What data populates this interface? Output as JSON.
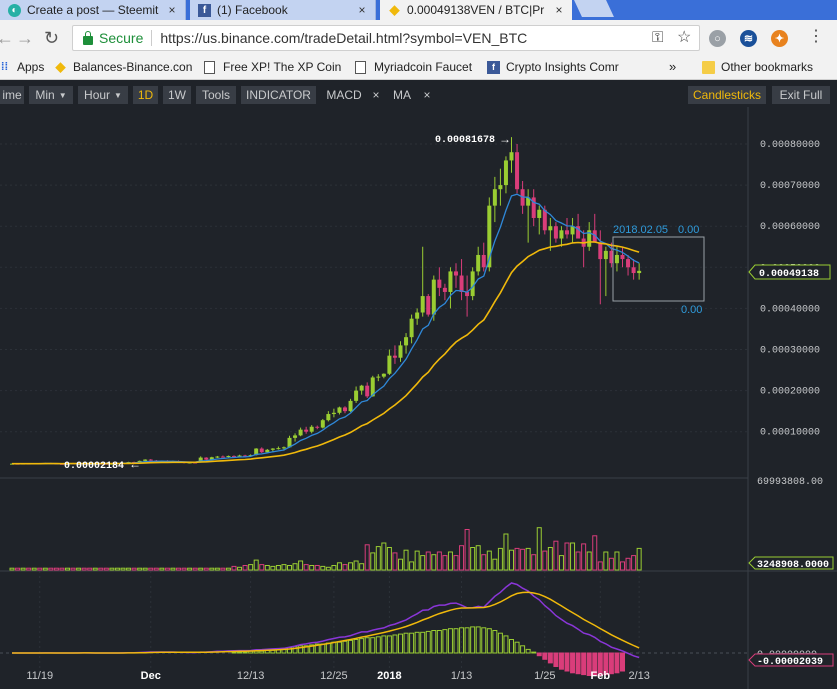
{
  "browser": {
    "tabs": [
      {
        "title": "Create a post — Steemit",
        "icon": "steemit-icon",
        "active": false
      },
      {
        "title": "(1) Facebook",
        "icon": "facebook-icon",
        "active": false
      },
      {
        "title": "0.00049138VEN / BTC|Pr",
        "icon": "binance-icon",
        "active": true
      }
    ],
    "secure_label": "Secure",
    "url": "https://us.binance.com/tradeDetail.html?symbol=VEN_BTC",
    "bookmarks": [
      {
        "label": "Apps",
        "icon": "apps-grid-icon"
      },
      {
        "label": "Balances-Binance.con",
        "icon": "binance-icon"
      },
      {
        "label": "Free XP! The XP Coin",
        "icon": "page-icon"
      },
      {
        "label": "Myriadcoin Faucet",
        "icon": "page-icon"
      },
      {
        "label": "Crypto Insights Comr",
        "icon": "facebook-icon"
      }
    ],
    "more_bookmarks": "»",
    "other_bookmarks": "Other bookmarks"
  },
  "toolbar": {
    "time_label": "ime",
    "min_label": "Min",
    "hour_label": "Hour",
    "d1_label": "1D",
    "w1_label": "1W",
    "tools_label": "Tools",
    "indicator_label": "INDICATOR",
    "macd_label": "MACD",
    "ma_label": "MA",
    "close_glyph": "×",
    "candlesticks_label": "Candlesticks",
    "exit_label": "Exit Full"
  },
  "colors": {
    "up": "#9acd32",
    "down": "#d93d7a",
    "ma_fast": "#2f88d8",
    "ma_slow": "#f0b90b",
    "macd_line": "#8a36d8",
    "accent": "#f0b90b"
  },
  "chart_data": {
    "type": "candlestick",
    "pair": "VEN / BTC",
    "interval": "1D",
    "y_ticks": [
      "0.00080000",
      "0.00070000",
      "0.00060000",
      "0.00050000",
      "0.00040000",
      "0.00030000",
      "0.00020000",
      "0.00010000"
    ],
    "y_range": [
      0.0,
      0.00081678
    ],
    "x_ticks": [
      "11/19",
      "Dec",
      "12/13",
      "12/25",
      "2018",
      "1/13",
      "1/25",
      "Feb",
      "2/13"
    ],
    "annotations": {
      "high_label": "0.00081678",
      "low_label": "0.00002184",
      "current_price": "0.00049138",
      "range_date": "2018.02.05",
      "range_top_value": "0.00",
      "range_bottom_value": "0.00"
    },
    "volume": {
      "max_label": "69993808.00",
      "current_label": "3248908.0000"
    },
    "macd": {
      "zero_label": "0.00000000",
      "current_label": "-0.00002039"
    },
    "candles": [
      [
        2.15e-05,
        2.28e-05,
        2.08e-05,
        2.22e-05
      ],
      [
        2.22e-05,
        2.35e-05,
        2.12e-05,
        2.18e-05
      ],
      [
        2.18e-05,
        2.3e-05,
        2.1e-05,
        2.25e-05
      ],
      [
        2.25e-05,
        2.36e-05,
        2.15e-05,
        2.19e-05
      ],
      [
        2.19e-05,
        2.38e-05,
        2.14e-05,
        2.32e-05
      ],
      [
        2.32e-05,
        2.4e-05,
        2.16e-05,
        2.2e-05
      ],
      [
        2.2e-05,
        2.41e-05,
        2.14e-05,
        2.36e-05
      ],
      [
        2.36e-05,
        2.44e-05,
        2.22e-05,
        2.26e-05
      ],
      [
        2.26e-05,
        2.36e-05,
        2.11e-05,
        2.18e-05
      ],
      [
        2.18e-05,
        2.28e-05,
        2.08e-05,
        2.15e-05
      ],
      [
        2.15e-05,
        2.38e-05,
        2.1e-05,
        2.31e-05
      ],
      [
        2.31e-05,
        2.43e-05,
        2.2e-05,
        2.25e-05
      ],
      [
        2.25e-05,
        2.4e-05,
        2.18e-05,
        2.36e-05
      ],
      [
        2.36e-05,
        2.46e-05,
        2.24e-05,
        2.28e-05
      ],
      [
        2.28e-05,
        2.34e-05,
        2.1e-05,
        2.18e-05
      ],
      [
        2.18e-05,
        2.3e-05,
        2.12e-05,
        2.24e-05
      ],
      [
        2.24e-05,
        2.36e-05,
        2.18e-05,
        2.21e-05
      ],
      [
        2.21e-05,
        2.25e-05,
        2.09e-05,
        2.13e-05
      ],
      [
        2.13e-05,
        2.25e-05,
        2.07e-05,
        2.2e-05
      ],
      [
        2.2e-05,
        2.42e-05,
        2.15e-05,
        2.36e-05
      ],
      [
        2.36e-05,
        2.55e-05,
        2.3e-05,
        2.48e-05
      ],
      [
        2.48e-05,
        2.68e-05,
        2.4e-05,
        2.62e-05
      ],
      [
        2.62e-05,
        2.72e-05,
        2.4e-05,
        2.48e-05
      ],
      [
        2.48e-05,
        2.98e-05,
        2.46e-05,
        2.9e-05
      ],
      [
        2.9e-05,
        3.3e-05,
        2.8e-05,
        3.22e-05
      ],
      [
        3.22e-05,
        3.35e-05,
        2.9e-05,
        3e-05
      ],
      [
        3e-05,
        3.12e-05,
        2.7e-05,
        2.82e-05
      ],
      [
        2.82e-05,
        3e-05,
        2.6e-05,
        2.92e-05
      ],
      [
        2.92e-05,
        3.05e-05,
        2.62e-05,
        2.7e-05
      ],
      [
        2.7e-05,
        2.95e-05,
        2.58e-05,
        2.86e-05
      ],
      [
        2.86e-05,
        3e-05,
        2.5e-05,
        2.62e-05
      ],
      [
        2.62e-05,
        2.68e-05,
        2.3e-05,
        2.4e-05
      ],
      [
        2.4e-05,
        2.6e-05,
        2.25e-05,
        2.52e-05
      ],
      [
        2.52e-05,
        2.7e-05,
        2.4e-05,
        2.5e-05
      ],
      [
        2.5e-05,
        4e-05,
        2.48e-05,
        3.7e-05
      ],
      [
        3.7e-05,
        3.8e-05,
        3e-05,
        3.2e-05
      ],
      [
        3.2e-05,
        3.9e-05,
        3.12e-05,
        3.78e-05
      ],
      [
        3.78e-05,
        4.1e-05,
        3.6e-05,
        3.95e-05
      ],
      [
        3.95e-05,
        4.2e-05,
        3.7e-05,
        3.85e-05
      ],
      [
        3.85e-05,
        4.2e-05,
        3.68e-05,
        4.1e-05
      ],
      [
        4.1e-05,
        4.25e-05,
        3.9e-05,
        4e-05
      ],
      [
        4e-05,
        4.4e-05,
        3.92e-05,
        4.2e-05
      ],
      [
        4.2e-05,
        4.38e-05,
        3.95e-05,
        4.05e-05
      ],
      [
        4.05e-05,
        4.48e-05,
        3.98e-05,
        4.3e-05
      ],
      [
        4.3e-05,
        6e-05,
        4.2e-05,
        5.9e-05
      ],
      [
        5.9e-05,
        6.2e-05,
        4.8e-05,
        5e-05
      ],
      [
        5e-05,
        5.8e-05,
        4.9e-05,
        5.6e-05
      ],
      [
        5.6e-05,
        6e-05,
        5.1e-05,
        5.9e-05
      ],
      [
        5.9e-05,
        6.4e-05,
        5.65e-05,
        6e-05
      ],
      [
        6e-05,
        6.4e-05,
        5.4e-05,
        6.2e-05
      ],
      [
        6.2e-05,
        9e-05,
        6.1e-05,
        8.5e-05
      ],
      [
        8.5e-05,
        9.6e-05,
        7.6e-05,
        9.1e-05
      ],
      [
        9.1e-05,
        0.00011,
        8.9e-05,
        0.000105
      ],
      [
        0.000105,
        0.000112,
        9.5e-05,
        0.0001
      ],
      [
        0.0001,
        0.000116,
        9.6e-05,
        0.000112
      ],
      [
        0.000112,
        0.000115,
        0.000106,
        0.00011
      ],
      [
        0.00011,
        0.000131,
        0.000108,
        0.000128
      ],
      [
        0.000128,
        0.00015,
        0.000125,
        0.000143
      ],
      [
        0.000143,
        0.000156,
        0.000135,
        0.000146
      ],
      [
        0.000146,
        0.000161,
        0.000142,
        0.000159
      ],
      [
        0.000159,
        0.000162,
        0.000145,
        0.00015
      ],
      [
        0.00015,
        0.00018,
        0.000148,
        0.000175
      ],
      [
        0.000175,
        0.00021,
        0.00017,
        0.0002
      ],
      [
        0.0002,
        0.000214,
        0.00019,
        0.000212
      ],
      [
        0.000212,
        0.00022,
        0.000182,
        0.000186
      ],
      [
        0.000186,
        0.000236,
        0.000185,
        0.000232
      ],
      [
        0.000232,
        0.00024,
        0.000223,
        0.000234
      ],
      [
        0.000234,
        0.000242,
        0.00023,
        0.000241
      ],
      [
        0.000241,
        0.0003,
        0.000238,
        0.000285
      ],
      [
        0.000285,
        0.00031,
        0.000265,
        0.00028
      ],
      [
        0.00028,
        0.00032,
        0.00027,
        0.00031
      ],
      [
        0.00031,
        0.00034,
        0.00029,
        0.00033
      ],
      [
        0.00033,
        0.000385,
        0.000315,
        0.000375
      ],
      [
        0.000375,
        0.0004,
        0.00036,
        0.00039
      ],
      [
        0.00039,
        0.00055,
        0.00038,
        0.00043
      ],
      [
        0.00043,
        0.000435,
        0.00038,
        0.000385
      ],
      [
        0.000385,
        0.00048,
        0.00037,
        0.00047
      ],
      [
        0.00047,
        0.0005,
        0.00043,
        0.00045
      ],
      [
        0.00045,
        0.00046,
        0.00042,
        0.00044
      ],
      [
        0.00044,
        0.0005,
        0.0004,
        0.00049
      ],
      [
        0.00049,
        0.00051,
        0.00045,
        0.00048
      ],
      [
        0.00048,
        0.00052,
        0.00042,
        0.00044
      ],
      [
        0.00044,
        0.00048,
        0.00038,
        0.00043
      ],
      [
        0.00043,
        0.0005,
        0.00042,
        0.00049
      ],
      [
        0.00049,
        0.00055,
        0.00048,
        0.00053
      ],
      [
        0.00053,
        0.00056,
        0.00049,
        0.0005
      ],
      [
        0.0005,
        0.00067,
        0.00049,
        0.00065
      ],
      [
        0.00065,
        0.00072,
        0.00061,
        0.00069
      ],
      [
        0.00069,
        0.00074,
        0.00065,
        0.0007
      ],
      [
        0.0007,
        0.00077,
        0.00068,
        0.00076
      ],
      [
        0.00076,
        0.0008168,
        0.00073,
        0.00078
      ],
      [
        0.00078,
        0.0008,
        0.00068,
        0.00069
      ],
      [
        0.00069,
        0.00071,
        0.00063,
        0.00065
      ],
      [
        0.00065,
        0.00069,
        0.00056,
        0.00067
      ],
      [
        0.00067,
        0.00069,
        0.0006,
        0.00062
      ],
      [
        0.00062,
        0.00065,
        0.00058,
        0.00064
      ],
      [
        0.00064,
        0.00065,
        0.00058,
        0.00059
      ],
      [
        0.00059,
        0.00062,
        0.00054,
        0.0006
      ],
      [
        0.0006,
        0.00061,
        0.00056,
        0.00057
      ],
      [
        0.00057,
        0.0006,
        0.00055,
        0.00059
      ],
      [
        0.00059,
        0.00062,
        0.00057,
        0.00058
      ],
      [
        0.00058,
        0.00062,
        0.00056,
        0.0006
      ],
      [
        0.0006,
        0.00063,
        0.00058,
        0.00057
      ],
      [
        0.00057,
        0.00059,
        0.0005,
        0.00055
      ],
      [
        0.00055,
        0.00061,
        0.00054,
        0.00059
      ],
      [
        0.00059,
        0.00063,
        0.00056,
        0.00056
      ],
      [
        0.00056,
        0.00059,
        0.00041,
        0.00052
      ],
      [
        0.00052,
        0.00055,
        0.00043,
        0.00054
      ],
      [
        0.00054,
        0.00056,
        0.0005,
        0.00051
      ],
      [
        0.00051,
        0.00055,
        0.00049,
        0.00053
      ],
      [
        0.00053,
        0.00055,
        0.0005,
        0.00052
      ],
      [
        0.00052,
        0.00053,
        0.00048,
        0.0005
      ],
      [
        0.0005,
        0.00052,
        0.00047,
        0.000486
      ],
      [
        0.000486,
        0.00051,
        0.00047,
        0.0004914
      ]
    ],
    "volumes": [
      0.02,
      0.02,
      0.02,
      0.02,
      0.02,
      0.02,
      0.02,
      0.02,
      0.02,
      0.02,
      0.02,
      0.02,
      0.02,
      0.02,
      0.02,
      0.02,
      0.02,
      0.02,
      0.02,
      0.02,
      0.02,
      0.02,
      0.02,
      0.02,
      0.02,
      0.02,
      0.02,
      0.02,
      0.02,
      0.02,
      0.02,
      0.02,
      0.02,
      0.02,
      0.02,
      0.02,
      0.02,
      0.02,
      0.02,
      0.02,
      0.04,
      0.03,
      0.05,
      0.06,
      0.11,
      0.06,
      0.05,
      0.04,
      0.05,
      0.06,
      0.05,
      0.07,
      0.1,
      0.06,
      0.05,
      0.05,
      0.04,
      0.03,
      0.05,
      0.08,
      0.06,
      0.08,
      0.1,
      0.07,
      0.28,
      0.19,
      0.26,
      0.3,
      0.25,
      0.19,
      0.12,
      0.22,
      0.09,
      0.21,
      0.16,
      0.2,
      0.17,
      0.2,
      0.16,
      0.2,
      0.16,
      0.27,
      0.45,
      0.25,
      0.27,
      0.17,
      0.21,
      0.12,
      0.24,
      0.4,
      0.22,
      0.24,
      0.23,
      0.24,
      0.17,
      0.47,
      0.21,
      0.25,
      0.32,
      0.16,
      0.3,
      0.3,
      0.2,
      0.29,
      0.2,
      0.38,
      0.09,
      0.2,
      0.13,
      0.2,
      0.09,
      0.13,
      0.16,
      0.24,
      0.11,
      0.14,
      0.17,
      0.12,
      0.14,
      0.1,
      0.16,
      0.05,
      0.08,
      0.05,
      0.03,
      0.05,
      0.03
    ],
    "macd_hist": [
      0,
      0,
      0,
      0,
      0,
      0,
      0,
      0,
      0,
      0,
      0,
      0,
      0,
      0,
      0,
      0,
      0,
      0,
      0,
      0,
      0,
      0,
      0,
      0,
      0,
      0,
      0,
      0,
      0,
      0,
      0,
      0,
      0,
      0,
      0,
      0,
      0,
      0,
      0,
      0,
      0.01,
      0.01,
      0.01,
      0.02,
      0.02,
      0.02,
      0.03,
      0.03,
      0.04,
      0.05,
      0.06,
      0.07,
      0.08,
      0.08,
      0.09,
      0.1,
      0.1,
      0.11,
      0.12,
      0.12,
      0.13,
      0.14,
      0.15,
      0.16,
      0.17,
      0.17,
      0.18,
      0.19,
      0.19,
      0.2,
      0.21,
      0.22,
      0.22,
      0.23,
      0.23,
      0.24,
      0.25,
      0.25,
      0.26,
      0.27,
      0.27,
      0.28,
      0.28,
      0.29,
      0.29,
      0.28,
      0.27,
      0.25,
      0.22,
      0.19,
      0.15,
      0.12,
      0.08,
      0.04,
      0.01,
      -0.03,
      -0.07,
      -0.11,
      -0.15,
      -0.18,
      -0.2,
      -0.22,
      -0.23,
      -0.24,
      -0.25,
      -0.25,
      -0.25,
      -0.24,
      -0.23,
      -0.22,
      -0.2
    ]
  }
}
